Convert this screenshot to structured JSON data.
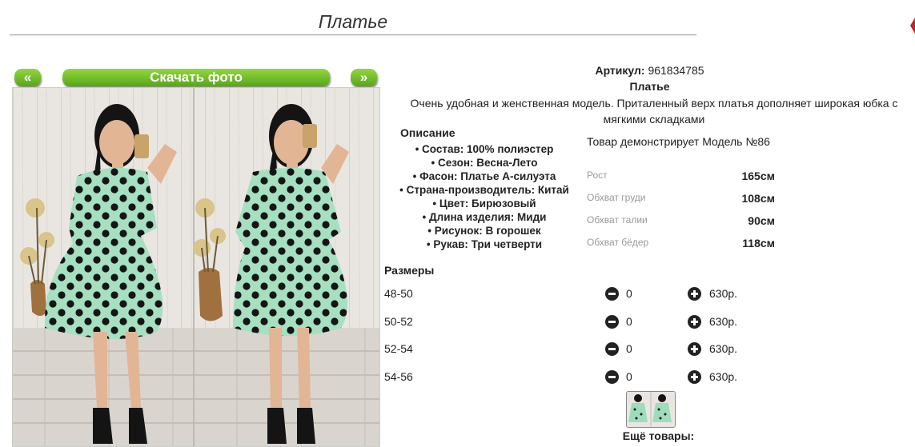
{
  "header": {
    "title": "Платье"
  },
  "gallery": {
    "prev_label": "«",
    "next_label": "»",
    "download_label": "Скачать фото"
  },
  "product": {
    "article_label": "Артикул:",
    "article_value": "961834785",
    "name": "Платье",
    "description": "Очень удобная и женственная модель. Приталенный верх платья дополняет широкая юбка с мягкими складками",
    "specs_title": "Описание",
    "specs": [
      "Состав: 100% полиэстер",
      "Сезон: Весна-Лето",
      "Фасон: Платье А-силуэта",
      "Страна-производитель: Китай",
      "Цвет: Бирюзовый",
      "Длина изделия: Миди",
      "Рисунок: В горошек",
      "Рукав: Три четверти"
    ],
    "model_text": "Товар демонстрирует Модель №86",
    "measurements": [
      {
        "label": "Рост",
        "value": "165см"
      },
      {
        "label": "Обхват груди",
        "value": "108см"
      },
      {
        "label": "Обхват талии",
        "value": "90см"
      },
      {
        "label": "Обхват бёдер",
        "value": "118см"
      }
    ]
  },
  "sizes": {
    "title": "Размеры",
    "rows": [
      {
        "size": "48-50",
        "qty": "0",
        "price": "630р."
      },
      {
        "size": "50-52",
        "qty": "0",
        "price": "630р."
      },
      {
        "size": "52-54",
        "qty": "0",
        "price": "630р."
      },
      {
        "size": "54-56",
        "qty": "0",
        "price": "630р."
      }
    ]
  },
  "more": {
    "label": "Ещё товары:"
  },
  "colors": {
    "button_green": "#58a51b",
    "dress_mint": "#9fdcbc",
    "accent_red": "#c0262d"
  }
}
